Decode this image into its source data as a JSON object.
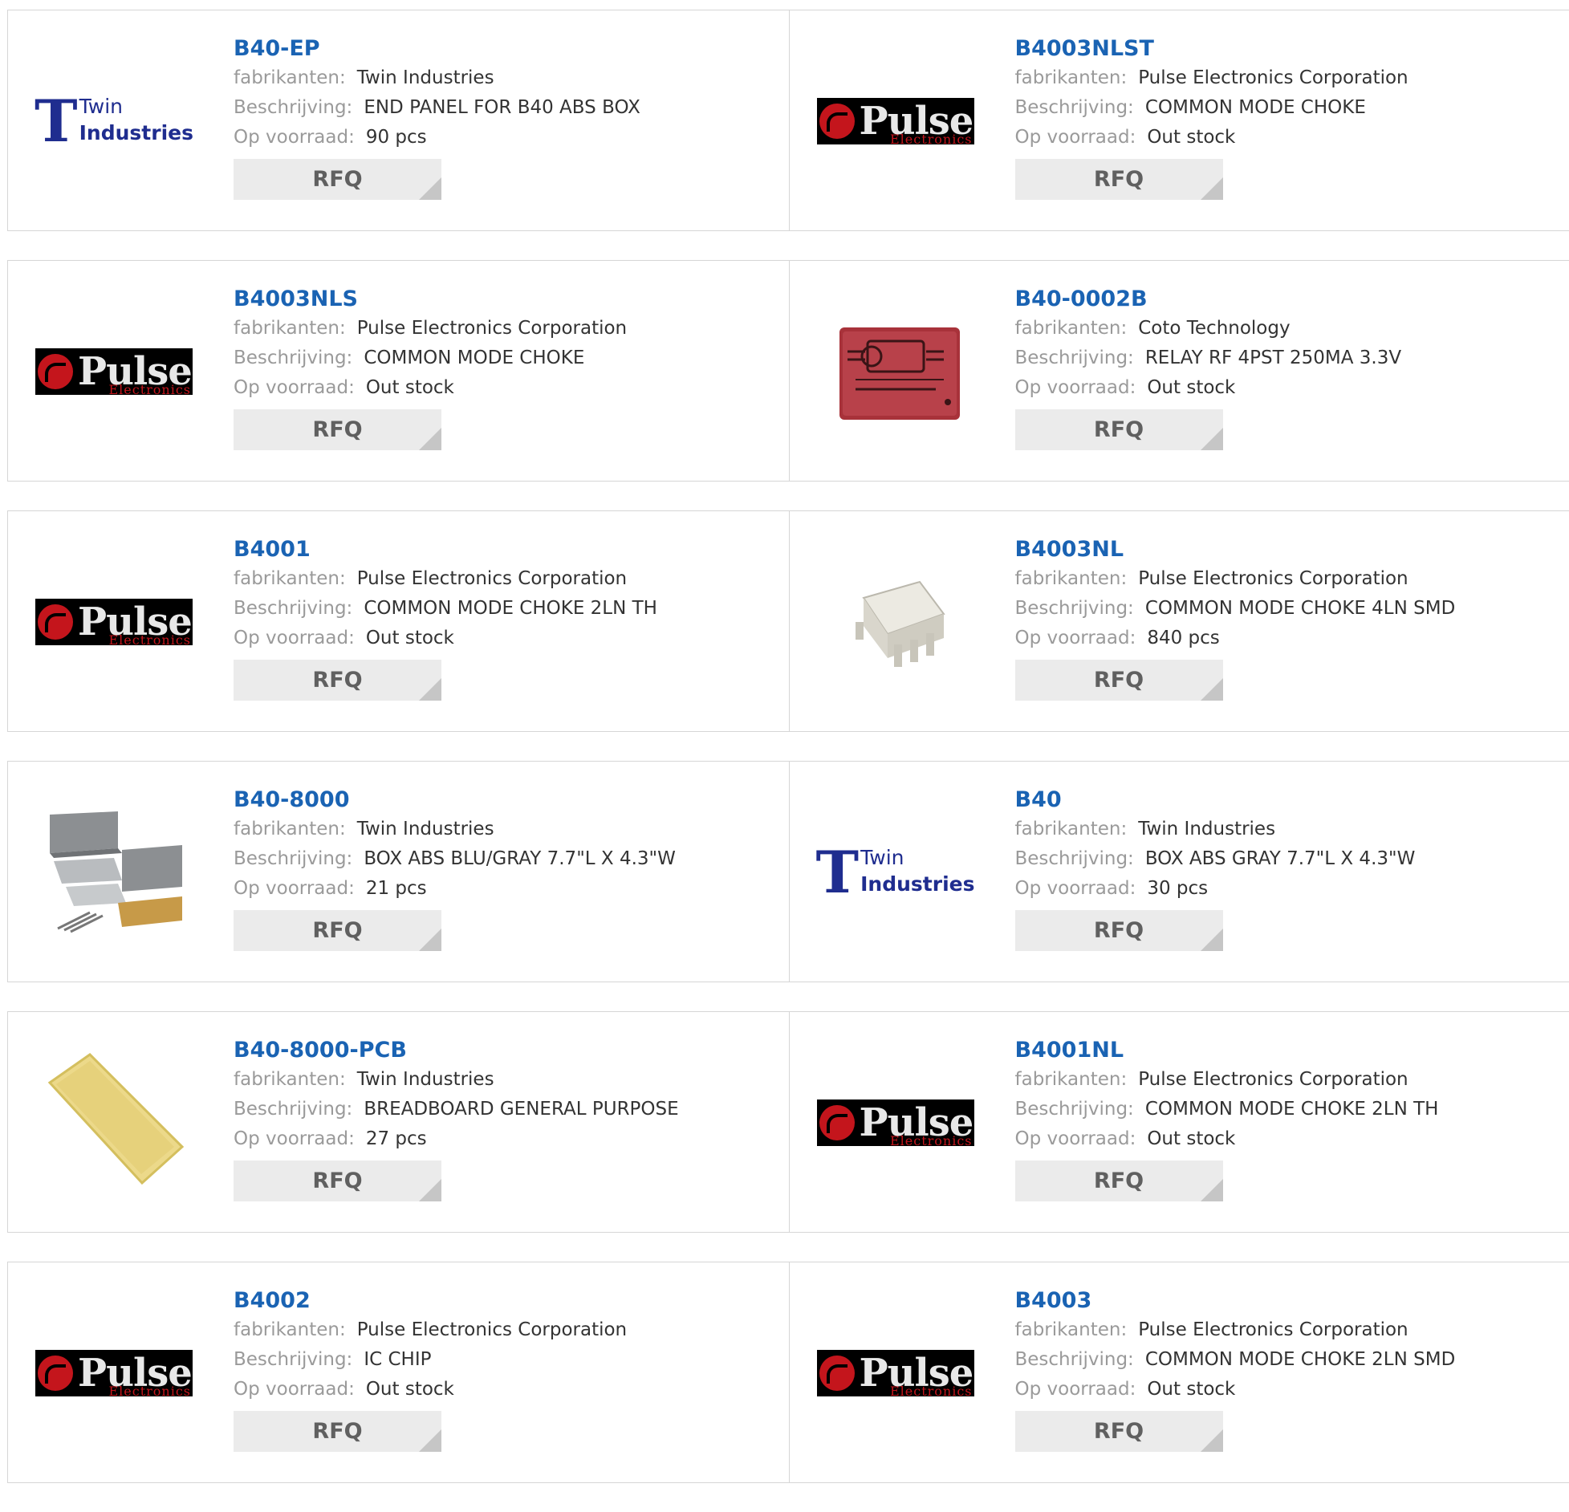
{
  "labels": {
    "manufacturer": "fabrikanten:",
    "description": "Beschrijving:",
    "stock": "Op voorraad:",
    "rfq": "RFQ"
  },
  "logos": {
    "pulse_word": "Pulse",
    "pulse_sub": "Electronics",
    "twin_T": "T",
    "twin_w1": "Twin",
    "twin_w2": "Industries"
  },
  "colors": {
    "link": "#1a63b3",
    "button_bg": "#ebebeb",
    "border": "#d6d6d6"
  },
  "products": [
    {
      "part": "B40-EP",
      "manufacturer": "Twin Industries",
      "description": "END PANEL FOR B40 ABS BOX",
      "stock": "90 pcs",
      "image": "twin-logo"
    },
    {
      "part": "B4003NLST",
      "manufacturer": "Pulse Electronics Corporation",
      "description": "COMMON MODE CHOKE",
      "stock": "Out stock",
      "image": "pulse-logo"
    },
    {
      "part": "B4003NLS",
      "manufacturer": "Pulse Electronics Corporation",
      "description": "COMMON MODE CHOKE",
      "stock": "Out stock",
      "image": "pulse-logo"
    },
    {
      "part": "B40-0002B",
      "manufacturer": "Coto Technology",
      "description": "RELAY RF 4PST 250MA 3.3V",
      "stock": "Out stock",
      "image": "relay-photo"
    },
    {
      "part": "B4001",
      "manufacturer": "Pulse Electronics Corporation",
      "description": "COMMON MODE CHOKE 2LN TH",
      "stock": "Out stock",
      "image": "pulse-logo"
    },
    {
      "part": "B4003NL",
      "manufacturer": "Pulse Electronics Corporation",
      "description": "COMMON MODE CHOKE 4LN SMD",
      "stock": "840 pcs",
      "image": "smd-choke-photo"
    },
    {
      "part": "B40-8000",
      "manufacturer": "Twin Industries",
      "description": "BOX ABS BLU/GRAY 7.7\"L X 4.3\"W",
      "stock": "21 pcs",
      "image": "enclosure-kit-photo"
    },
    {
      "part": "B40",
      "manufacturer": "Twin Industries",
      "description": "BOX ABS GRAY 7.7\"L X 4.3\"W",
      "stock": "30 pcs",
      "image": "twin-logo"
    },
    {
      "part": "B40-8000-PCB",
      "manufacturer": "Twin Industries",
      "description": "BREADBOARD GENERAL PURPOSE",
      "stock": "27 pcs",
      "image": "pcb-photo"
    },
    {
      "part": "B4001NL",
      "manufacturer": "Pulse Electronics Corporation",
      "description": "COMMON MODE CHOKE 2LN TH",
      "stock": "Out stock",
      "image": "pulse-logo"
    },
    {
      "part": "B4002",
      "manufacturer": "Pulse Electronics Corporation",
      "description": "IC CHIP",
      "stock": "Out stock",
      "image": "pulse-logo"
    },
    {
      "part": "B4003",
      "manufacturer": "Pulse Electronics Corporation",
      "description": "COMMON MODE CHOKE 2LN SMD",
      "stock": "Out stock",
      "image": "pulse-logo"
    }
  ]
}
